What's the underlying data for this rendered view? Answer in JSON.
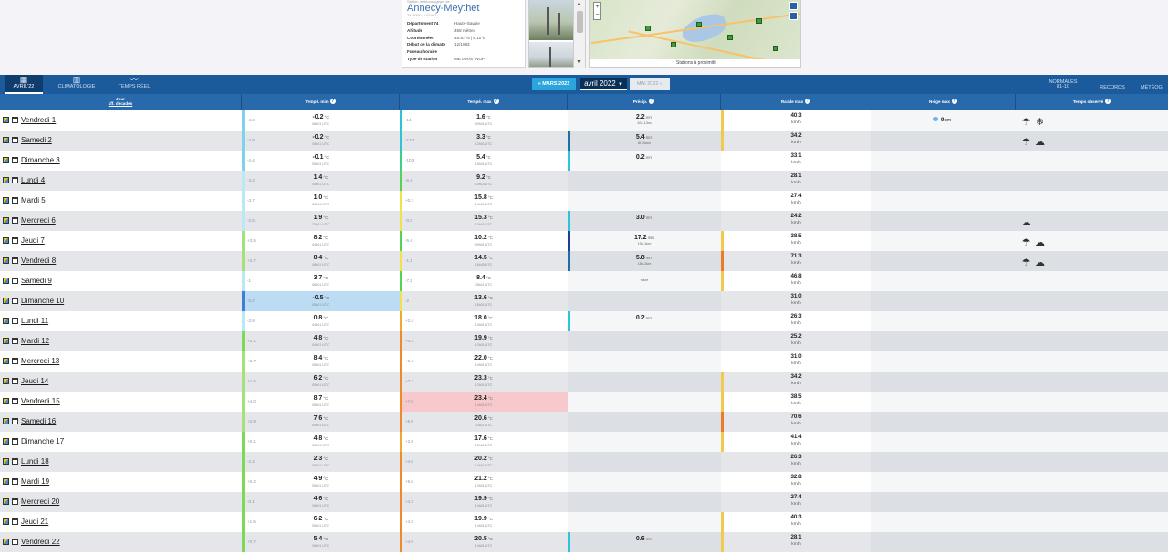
{
  "station": {
    "supertitle": "Station météorologique de",
    "name": "Annecy-Meythet",
    "subtitle": "74182001 / 07497",
    "details": [
      {
        "label": "Département 74",
        "value": "Haute-Savoie"
      },
      {
        "label": "Altitude",
        "value": "458 mètres"
      },
      {
        "label": "Coordonnées",
        "value": "45.93°N | 6.10°E"
      },
      {
        "label": "Début de la climato",
        "value": "12/1983"
      },
      {
        "label": "Fuseau horaire",
        "value": ""
      },
      {
        "label": "Type de station",
        "value": "METAR/SYNOP"
      }
    ]
  },
  "map": {
    "footer": "Stations à proximité",
    "zoom_in": "+",
    "zoom_out": "−"
  },
  "nav": {
    "tabs": [
      {
        "label": "AVRIL'22",
        "icon": "calendar-grid-icon",
        "glyph": "▦"
      },
      {
        "label": "CLIMATOLOGIE",
        "icon": "book-icon",
        "glyph": "▥"
      },
      {
        "label": "TEMPS RÉEL",
        "icon": "trend-icon",
        "glyph": "〰"
      }
    ],
    "right_tabs": [
      {
        "label": "NORMALES",
        "sub": "81-10"
      },
      {
        "label": "RECORDS",
        "sub": ""
      },
      {
        "label": "MÉTÉOG",
        "sub": ""
      }
    ],
    "prev_month": "« MARS 2022",
    "current_month": "avril 2022",
    "next_month": "MAI 2022 »"
  },
  "columns": {
    "day": "Jour",
    "day_link": "aff. décades",
    "tmin": "Tempé. min",
    "tmax": "Tempé. max",
    "precip": "Précip.",
    "gust": "Rafale max",
    "snow": "Neige max",
    "weather": "Temps observé"
  },
  "units": {
    "temp": "°C",
    "precip": "mm",
    "gust": "km/h",
    "snow": "cm"
  },
  "rows": [
    {
      "day": "Vendredi 1",
      "min_anom": "-4.8",
      "min": "-0.2",
      "min_time": "06h01 UTC",
      "max_anom": "-14",
      "max": "1.6",
      "max_time": "09h01 UTC",
      "precip": "2.2",
      "precip_note": "10h-13nc",
      "gust": "40.3",
      "snow": "9",
      "weather": [
        "snow-rain-icon",
        "snowflake-icon"
      ],
      "min_color": "#7fd1ec",
      "max_color": "#2ec4d6",
      "pre_color": "",
      "gust_color": "#f2c94c"
    },
    {
      "day": "Samedi 2",
      "min_anom": "-4.8",
      "min": "-0.2",
      "min_time": "05h01 UTC",
      "max_anom": "-12.3",
      "max": "3.3",
      "max_time": "13h01 UTC",
      "precip": "5.4",
      "precip_note": "6h-5ann",
      "gust": "34.2",
      "snow": "",
      "weather": [
        "snow-rain-icon",
        "rain-cloud-icon"
      ],
      "min_color": "#7fd1ec",
      "max_color": "#2ec4d6",
      "pre_color": "#1e6ea8",
      "gust_color": "#f2c94c"
    },
    {
      "day": "Dimanche 3",
      "min_anom": "-4.4",
      "min": "-0.1",
      "min_time": "05h01 UTC",
      "max_anom": "-10.3",
      "max": "5.4",
      "max_time": "15h01 UTC",
      "precip": "0.2",
      "precip_note": "",
      "gust": "33.1",
      "snow": "",
      "weather": [],
      "min_color": "#7fd1ec",
      "max_color": "#3dcf8a",
      "pre_color": "#2ec4d6",
      "gust_color": ""
    },
    {
      "day": "Lundi 4",
      "min_anom": "-3.3",
      "min": "1.4",
      "min_time": "05h01 UTC",
      "max_anom": "-6.4",
      "max": "9.2",
      "max_time": "15h14 UTC",
      "precip": "",
      "precip_note": "",
      "gust": "28.1",
      "snow": "",
      "weather": [],
      "min_color": "#b9e9f5",
      "max_color": "#54d357",
      "pre_color": "",
      "gust_color": ""
    },
    {
      "day": "Mardi 5",
      "min_anom": "-3.7",
      "min": "1.0",
      "min_time": "05h01 UTC",
      "max_anom": "+0.2",
      "max": "15.8",
      "max_time": "14h01 UTC",
      "precip": "",
      "precip_note": "",
      "gust": "27.4",
      "snow": "",
      "weather": [],
      "min_color": "#b9e9f5",
      "max_color": "#f2e24a",
      "pre_color": "",
      "gust_color": ""
    },
    {
      "day": "Mercredi 6",
      "min_anom": "-2.8",
      "min": "1.9",
      "min_time": "23h01 UTC",
      "max_anom": "-0.3",
      "max": "15.3",
      "max_time": "13h01 UTC",
      "precip": "3.0",
      "precip_note": "",
      "gust": "24.2",
      "snow": "",
      "weather": [
        "rain-cloud-icon"
      ],
      "min_color": "#b9e9f5",
      "max_color": "#f2e24a",
      "pre_color": "#2ec4d6",
      "gust_color": ""
    },
    {
      "day": "Jeudi 7",
      "min_anom": "+3.5",
      "min": "8.2",
      "min_time": "04h01 UTC",
      "max_anom": "-5.4",
      "max": "10.2",
      "max_time": "09h01 UTC",
      "precip": "17.2",
      "precip_note": "10h-1km",
      "gust": "38.5",
      "snow": "",
      "weather": [
        "snow-rain-icon",
        "rain-cloud-icon"
      ],
      "min_color": "#a6e07a",
      "max_color": "#54d357",
      "pre_color": "#1d3e9e",
      "gust_color": "#f2c94c"
    },
    {
      "day": "Vendredi 8",
      "min_anom": "+3.7",
      "min": "8.4",
      "min_time": "06h01 UTC",
      "max_anom": "-1.1",
      "max": "14.5",
      "max_time": "16h45 UTC",
      "precip": "5.8",
      "precip_note": "11h-2km",
      "gust": "71.3",
      "snow": "",
      "weather": [
        "snow-rain-icon",
        "rain-cloud-icon"
      ],
      "min_color": "#a6e07a",
      "max_color": "#f2e24a",
      "pre_color": "#1e6ea8",
      "gust_color": "#e97b2b"
    },
    {
      "day": "Samedi 9",
      "min_anom": "-1",
      "min": "3.7",
      "min_time": "06h01 UTC",
      "max_anom": "-7.2",
      "max": "8.4",
      "max_time": "15h11 UTC",
      "precip": "",
      "precip_note": "trace",
      "gust": "46.8",
      "snow": "",
      "weather": [],
      "min_color": "#b9e9f5",
      "max_color": "#54d357",
      "pre_color": "",
      "gust_color": "#f2c94c"
    },
    {
      "day": "Dimanche 10",
      "min_anom": "-5.2",
      "min": "-0.5",
      "min_time": "05h01 UTC",
      "max_anom": "-2",
      "max": "13.6",
      "max_time": "15h01 UTC",
      "precip": "",
      "precip_note": "",
      "gust": "31.0",
      "snow": "",
      "weather": [],
      "min_color": "#3c7fd6",
      "max_color": "#f2e24a",
      "pre_color": "",
      "gust_color": "",
      "min_hl": "cold"
    },
    {
      "day": "Lundi 11",
      "min_anom": "-3.9",
      "min": "0.8",
      "min_time": "04h01 UTC",
      "max_anom": "+2.4",
      "max": "18.0",
      "max_time": "13h01 UTC",
      "precip": "0.2",
      "precip_note": "",
      "gust": "26.3",
      "snow": "",
      "weather": [],
      "min_color": "#b9e9f5",
      "max_color": "#f0a830",
      "pre_color": "#2ec4d6",
      "gust_color": ""
    },
    {
      "day": "Mardi 12",
      "min_anom": "+0.1",
      "min": "4.8",
      "min_time": "04h01 UTC",
      "max_anom": "+4.3",
      "max": "19.9",
      "max_time": "13h01 UTC",
      "precip": "",
      "precip_note": "",
      "gust": "25.2",
      "snow": "",
      "weather": [],
      "min_color": "#7ed957",
      "max_color": "#ee8a2a",
      "pre_color": "",
      "gust_color": ""
    },
    {
      "day": "Mercredi 13",
      "min_anom": "+3.7",
      "min": "8.4",
      "min_time": "05h01 UTC",
      "max_anom": "+6.4",
      "max": "22.0",
      "max_time": "14h01 UTC",
      "precip": "",
      "precip_note": "",
      "gust": "31.0",
      "snow": "",
      "weather": [],
      "min_color": "#a6e07a",
      "max_color": "#ee8a2a",
      "pre_color": "",
      "gust_color": ""
    },
    {
      "day": "Jeudi 14",
      "min_anom": "+1.5",
      "min": "6.2",
      "min_time": "05h01 UTC",
      "max_anom": "+7.7",
      "max": "23.3",
      "max_time": "13h01 UTC",
      "precip": "",
      "precip_note": "",
      "gust": "34.2",
      "snow": "",
      "weather": [],
      "min_color": "#a6e07a",
      "max_color": "#ee8a2a",
      "pre_color": "",
      "gust_color": "#f2c94c"
    },
    {
      "day": "Vendredi 15",
      "min_anom": "+4.0",
      "min": "8.7",
      "min_time": "05h01 UTC",
      "max_anom": "+7.8",
      "max": "23.4",
      "max_time": "14h01 UTC",
      "precip": "",
      "precip_note": "",
      "gust": "38.5",
      "snow": "",
      "weather": [],
      "min_color": "#a6e07a",
      "max_color": "#ee8a2a",
      "pre_color": "",
      "gust_color": "#f2c94c",
      "max_hl": "hot"
    },
    {
      "day": "Samedi 16",
      "min_anom": "+2.9",
      "min": "7.6",
      "min_time": "05h01 UTC",
      "max_anom": "+5.0",
      "max": "20.6",
      "max_time": "13h11 UTC",
      "precip": "",
      "precip_note": "",
      "gust": "70.6",
      "snow": "",
      "weather": [],
      "min_color": "#a6e07a",
      "max_color": "#ee8a2a",
      "pre_color": "",
      "gust_color": "#e97b2b"
    },
    {
      "day": "Dimanche 17",
      "min_anom": "+0.1",
      "min": "4.8",
      "min_time": "05h01 UTC",
      "max_anom": "+2.0",
      "max": "17.6",
      "max_time": "13h01 UTC",
      "precip": "",
      "precip_note": "",
      "gust": "41.4",
      "snow": "",
      "weather": [],
      "min_color": "#7ed957",
      "max_color": "#f0a830",
      "pre_color": "",
      "gust_color": "#f2c94c"
    },
    {
      "day": "Lundi 18",
      "min_anom": "-2.4",
      "min": "2.3",
      "min_time": "05h01 UTC",
      "max_anom": "+4.6",
      "max": "20.2",
      "max_time": "14h01 UTC",
      "precip": "",
      "precip_note": "",
      "gust": "26.3",
      "snow": "",
      "weather": [],
      "min_color": "#7ed957",
      "max_color": "#ee8a2a",
      "pre_color": "",
      "gust_color": ""
    },
    {
      "day": "Mardi 19",
      "min_anom": "+0.2",
      "min": "4.9",
      "min_time": "05h01 UTC",
      "max_anom": "+5.6",
      "max": "21.2",
      "max_time": "13h01 UTC",
      "precip": "",
      "precip_note": "",
      "gust": "32.8",
      "snow": "",
      "weather": [],
      "min_color": "#7ed957",
      "max_color": "#ee8a2a",
      "pre_color": "",
      "gust_color": ""
    },
    {
      "day": "Mercredi 20",
      "min_anom": "-0.1",
      "min": "4.6",
      "min_time": "05h01 UTC",
      "max_anom": "+4.3",
      "max": "19.9",
      "max_time": "14h01 UTC",
      "precip": "",
      "precip_note": "",
      "gust": "27.4",
      "snow": "",
      "weather": [],
      "min_color": "#7ed957",
      "max_color": "#ee8a2a",
      "pre_color": "",
      "gust_color": ""
    },
    {
      "day": "Jeudi 21",
      "min_anom": "+1.5",
      "min": "6.2",
      "min_time": "05h01 UTC",
      "max_anom": "+4.3",
      "max": "19.9",
      "max_time": "14h01 UTC",
      "precip": "",
      "precip_note": "",
      "gust": "40.3",
      "snow": "",
      "weather": [],
      "min_color": "#7ed957",
      "max_color": "#ee8a2a",
      "pre_color": "",
      "gust_color": "#f2c94c"
    },
    {
      "day": "Vendredi 22",
      "min_anom": "+0.7",
      "min": "5.4",
      "min_time": "05h01 UTC",
      "max_anom": "+4.9",
      "max": "20.5",
      "max_time": "14h01 UTC",
      "precip": "0.6",
      "precip_note": "",
      "gust": "28.1",
      "snow": "",
      "weather": [],
      "min_color": "#7ed957",
      "max_color": "#ee8a2a",
      "pre_color": "#2ec4d6",
      "gust_color": "#f2c94c"
    }
  ]
}
